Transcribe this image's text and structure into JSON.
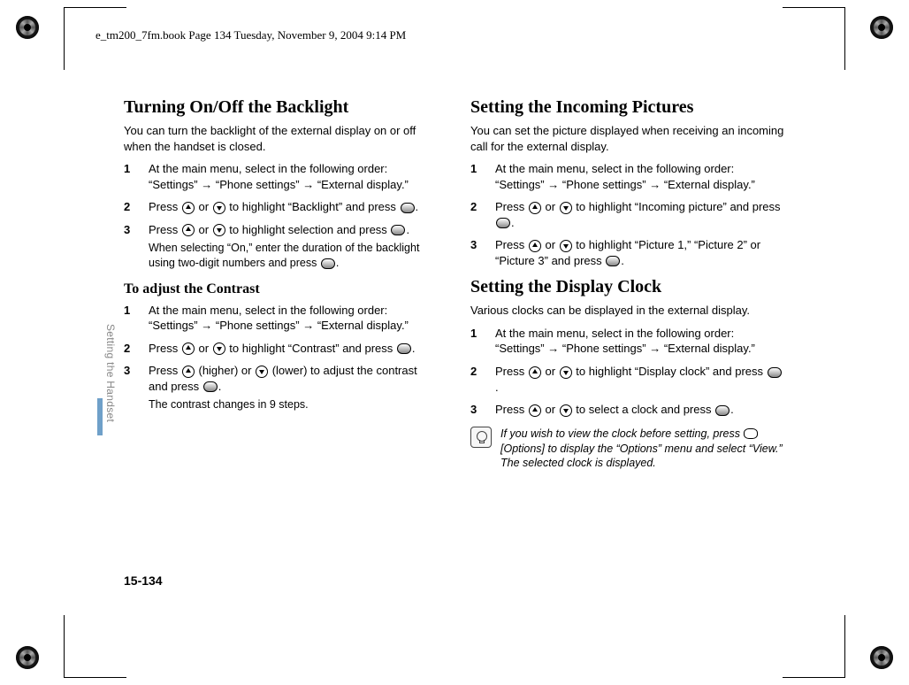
{
  "header": "e_tm200_7fm.book  Page 134  Tuesday, November 9, 2004  9:14 PM",
  "section_label": "Setting the Handset",
  "page_number": "15-134",
  "nums": [
    "1",
    "2",
    "3"
  ],
  "glyph": {
    "arrow": "→"
  },
  "common": {
    "press": "Press",
    "or": "or"
  },
  "left": {
    "h1": "Turning On/Off the Backlight",
    "intro1": "You can turn the backlight of the external display on or off when the handset is closed.",
    "s1a": "At the main menu, select in the following order: “Settings”",
    "s1b": "“Phone settings”",
    "s1c": "“External display.”",
    "s2": "to highlight “Backlight” and press",
    "s3": "to highlight selection and press",
    "s3sub": "When selecting “On,” enter the duration of the backlight using two-digit numbers and press",
    "h2": "To adjust the Contrast",
    "c2": "to highlight “Contrast” and press",
    "c3a": "(higher) or",
    "c3b": "(lower) to adjust the contrast and press",
    "c3sub": "The contrast changes in 9 steps."
  },
  "right": {
    "h1": "Setting the Incoming Pictures",
    "intro1": "You can set the picture displayed when receiving an incoming call for the external display.",
    "i2": "to highlight “Incoming picture” and press",
    "i3": "to highlight “Picture 1,” “Picture 2” or “Picture 3” and press",
    "h2": "Setting the Display Clock",
    "intro2": "Various clocks can be displayed in the external display.",
    "d2": "to highlight “Display clock” and press",
    "d3": "to select a clock and press",
    "tip1": "If you wish to view the clock before setting, press",
    "tip2": "[Options] to display the “Options” menu and select “View.” The selected clock is displayed."
  }
}
